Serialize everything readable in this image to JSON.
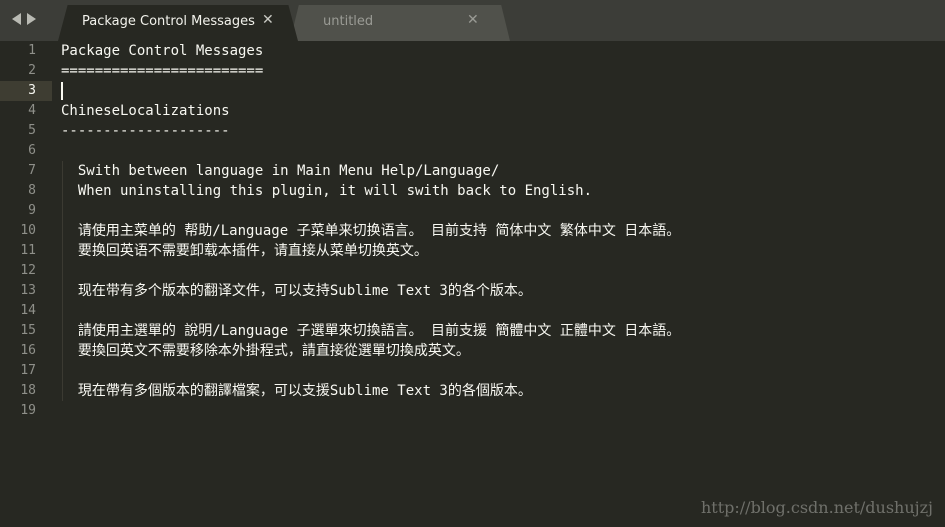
{
  "tabs": [
    {
      "label": "Package Control Messages",
      "active": true,
      "close": "✕"
    },
    {
      "label": "untitled",
      "active": false,
      "close": "✕"
    }
  ],
  "nav": {
    "back_icon": "arrow-left-icon",
    "forward_icon": "arrow-right-icon"
  },
  "editor": {
    "current_line": 3,
    "lines": [
      {
        "n": "1",
        "text": "Package Control Messages"
      },
      {
        "n": "2",
        "text": "========================"
      },
      {
        "n": "3",
        "text": ""
      },
      {
        "n": "4",
        "text": "ChineseLocalizations"
      },
      {
        "n": "5",
        "text": "--------------------"
      },
      {
        "n": "6",
        "text": ""
      },
      {
        "n": "7",
        "text": "  Swith between language in Main Menu Help/Language/"
      },
      {
        "n": "8",
        "text": "  When uninstalling this plugin, it will swith back to English."
      },
      {
        "n": "9",
        "text": ""
      },
      {
        "n": "10",
        "text": "  请使用主菜单的 帮助/Language 子菜单来切换语言。 目前支持 简体中文 繁体中文 日本語。"
      },
      {
        "n": "11",
        "text": "  要换回英语不需要卸载本插件，请直接从菜单切换英文。"
      },
      {
        "n": "12",
        "text": ""
      },
      {
        "n": "13",
        "text": "  现在带有多个版本的翻译文件，可以支持Sublime Text 3的各个版本。"
      },
      {
        "n": "14",
        "text": ""
      },
      {
        "n": "15",
        "text": "  請使用主選單的 說明/Language 子選單來切換語言。 目前支援 簡體中文 正體中文 日本語。"
      },
      {
        "n": "16",
        "text": "  要換回英文不需要移除本外掛程式，請直接從選單切換成英文。"
      },
      {
        "n": "17",
        "text": ""
      },
      {
        "n": "18",
        "text": "  現在帶有多個版本的翻譯檔案，可以支援Sublime Text 3的各個版本。"
      },
      {
        "n": "19",
        "text": ""
      }
    ]
  },
  "watermark": "http://blog.csdn.net/dushujzj",
  "colors": {
    "background": "#272822",
    "tabbar": "#3c3d38",
    "text": "#f8f8f2",
    "line_number": "#8f908a"
  }
}
